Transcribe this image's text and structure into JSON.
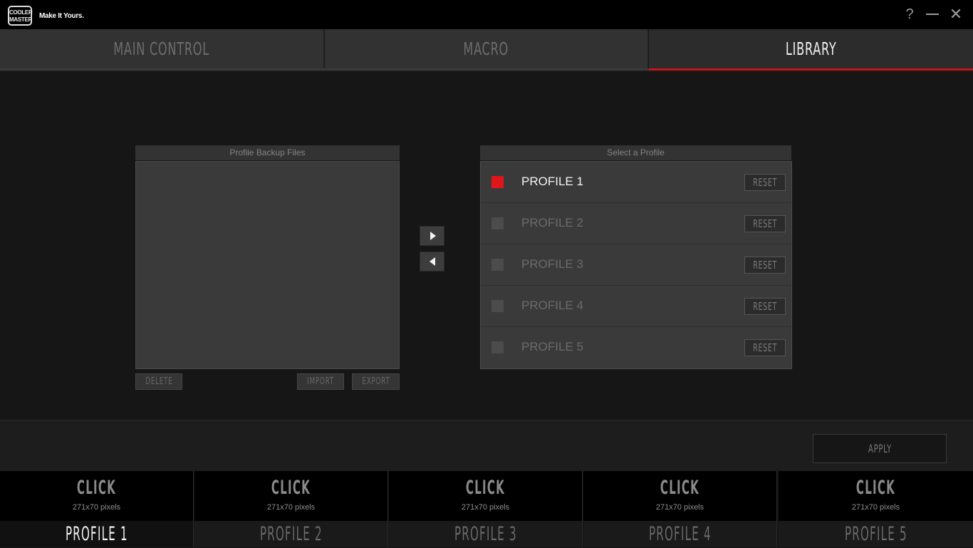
{
  "titlebar": {
    "logo_line1": "COOLER",
    "logo_line2": "MASTER",
    "tagline": "Make It Yours.",
    "help": "?",
    "close": "✕"
  },
  "tabs": [
    {
      "label": "MAIN CONTROL",
      "active": false
    },
    {
      "label": "MACRO",
      "active": false
    },
    {
      "label": "LIBRARY",
      "active": true
    }
  ],
  "accent_color": "#c8141a",
  "backup": {
    "title": "Profile Backup Files",
    "delete_label": "DELETE",
    "import_label": "IMPORT",
    "export_label": "EXPORT"
  },
  "profiles_panel": {
    "title": "Select a Profile",
    "reset_label": "RESET",
    "items": [
      {
        "name": "PROFILE 1",
        "selected": true
      },
      {
        "name": "PROFILE 2",
        "selected": false
      },
      {
        "name": "PROFILE 3",
        "selected": false
      },
      {
        "name": "PROFILE 4",
        "selected": false
      },
      {
        "name": "PROFILE 5",
        "selected": false
      }
    ]
  },
  "apply_label": "APPLY",
  "slots": [
    {
      "click": "CLICK",
      "dims": "271x70 pixels",
      "label": "PROFILE 1",
      "active": true
    },
    {
      "click": "CLICK",
      "dims": "271x70 pixels",
      "label": "PROFILE 2",
      "active": false
    },
    {
      "click": "CLICK",
      "dims": "271x70 pixels",
      "label": "PROFILE 3",
      "active": false
    },
    {
      "click": "CLICK",
      "dims": "271x70 pixels",
      "label": "PROFILE 4",
      "active": false
    },
    {
      "click": "CLICK",
      "dims": "271x70 pixels",
      "label": "PROFILE 5",
      "active": false
    }
  ]
}
